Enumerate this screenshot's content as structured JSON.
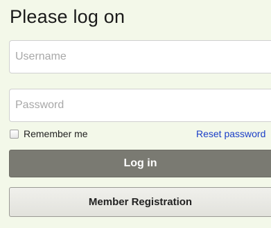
{
  "login": {
    "title": "Please log on",
    "username": {
      "value": "",
      "placeholder": "Username"
    },
    "password": {
      "value": "",
      "placeholder": "Password"
    },
    "remember_label": "Remember me",
    "remember_checked": false,
    "reset_label": "Reset password",
    "login_label": "Log in",
    "register_label": "Member Registration"
  },
  "colors": {
    "background": "#f3f8e9",
    "login_button": "#7a7a72",
    "link": "#1a3ec7"
  }
}
